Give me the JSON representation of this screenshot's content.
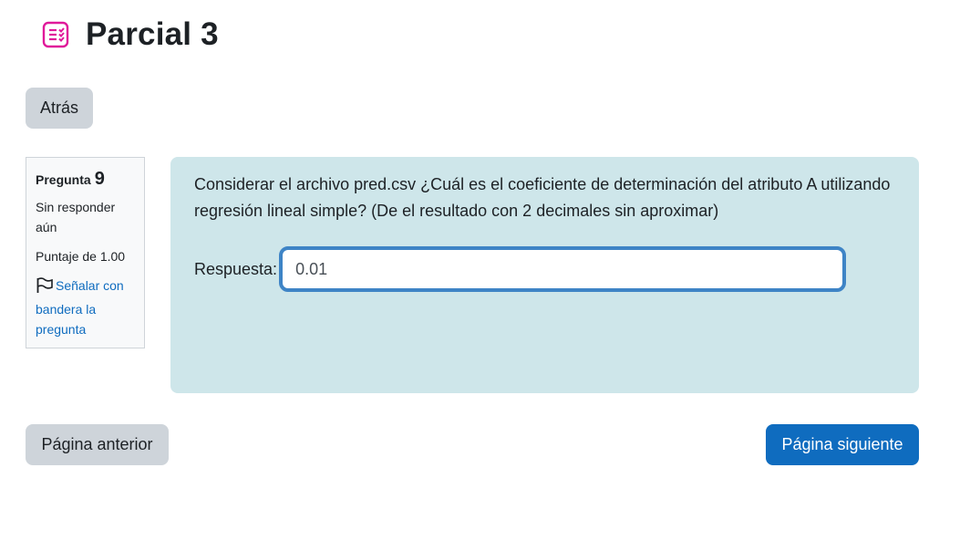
{
  "header": {
    "title": "Parcial 3",
    "icon": "quiz-icon",
    "icon_color": "#e0199a"
  },
  "nav": {
    "back_label": "Atrás",
    "prev_label": "Página anterior",
    "next_label": "Página siguiente"
  },
  "question_info": {
    "label": "Pregunta",
    "number": "9",
    "state": "Sin responder aún",
    "grade": "Puntaje de 1.00",
    "flag_label": "Señalar con bandera la pregunta",
    "flag_icon": "flag-icon"
  },
  "question": {
    "text": "Considerar el archivo pred.csv ¿Cuál es el coeficiente de determinación del atributo A utilizando regresión lineal simple? (De el resultado con 2 decimales sin aproximar)",
    "answer_label": "Respuesta:",
    "answer_value": "0.01"
  },
  "colors": {
    "primary": "#0f6cbf",
    "secondary": "#ced4da",
    "question_bg": "#cee6ea",
    "input_focus_border": "#3e84c6"
  }
}
